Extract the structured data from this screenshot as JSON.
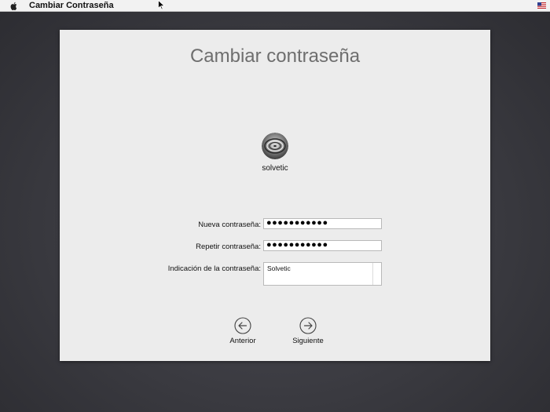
{
  "menubar": {
    "app_title": "Cambiar Contraseña",
    "apple_icon": "apple-icon",
    "flag_icon": "us-flag-icon"
  },
  "dialog": {
    "title": "Cambiar contraseña",
    "user": {
      "name": "solvetic",
      "avatar_icon": "user-avatar"
    },
    "fields": {
      "new_password": {
        "label": "Nueva contraseña:",
        "value": "●●●●●●●●●●●"
      },
      "repeat_password": {
        "label": "Repetir contraseña:",
        "value": "●●●●●●●●●●●"
      },
      "hint": {
        "label": "Indicación de la contraseña:",
        "value": "Solvetic"
      }
    },
    "buttons": {
      "back": {
        "label": "Anterior",
        "icon": "arrow-left-circle-icon"
      },
      "next": {
        "label": "Siguiente",
        "icon": "arrow-right-circle-icon"
      }
    }
  }
}
